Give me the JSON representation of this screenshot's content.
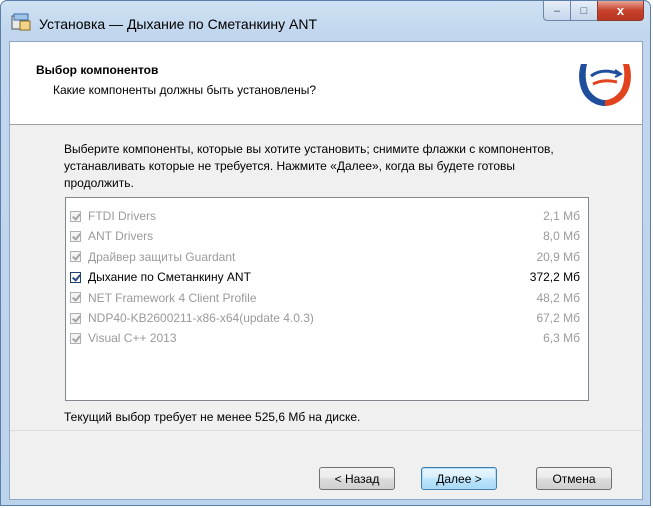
{
  "window": {
    "title": "Установка — Дыхание по Сметанкину ANT",
    "controls": {
      "minimize": "–",
      "maximize": "□",
      "close": "x"
    }
  },
  "header": {
    "title": "Выбор компонентов",
    "subtitle": "Какие компоненты должны быть установлены?"
  },
  "description": "Выберите компоненты, которые вы хотите установить; снимите флажки с компонентов, устанавливать которые не требуется. Нажмите «Далее», когда вы будете готовы продолжить.",
  "components": [
    {
      "name": "FTDI Drivers",
      "size": "2,1 Мб",
      "checked": true,
      "enabled": false
    },
    {
      "name": "ANT Drivers",
      "size": "8,0 Мб",
      "checked": true,
      "enabled": false
    },
    {
      "name": "Драйвер защиты Guardant",
      "size": "20,9 Мб",
      "checked": true,
      "enabled": false
    },
    {
      "name": "Дыхание по Сметанкину ANT",
      "size": "372,2 Мб",
      "checked": true,
      "enabled": true
    },
    {
      "name": "NET Framework 4 Client Profile",
      "size": "48,2 Мб",
      "checked": true,
      "enabled": false
    },
    {
      "name": "NDP40-KB2600211-x86-x64(update 4.0.3)",
      "size": "67,2 Мб",
      "checked": true,
      "enabled": false
    },
    {
      "name": "Visual C++ 2013",
      "size": "6,3 Мб",
      "checked": true,
      "enabled": false
    }
  ],
  "disk_requirement": "Текущий выбор требует не менее 525,6 Мб на диске.",
  "buttons": {
    "back": "< Назад",
    "next": "Далее >",
    "cancel": "Отмена"
  },
  "colors": {
    "logo_blue": "#1f4e9c",
    "logo_red": "#e2431f"
  }
}
